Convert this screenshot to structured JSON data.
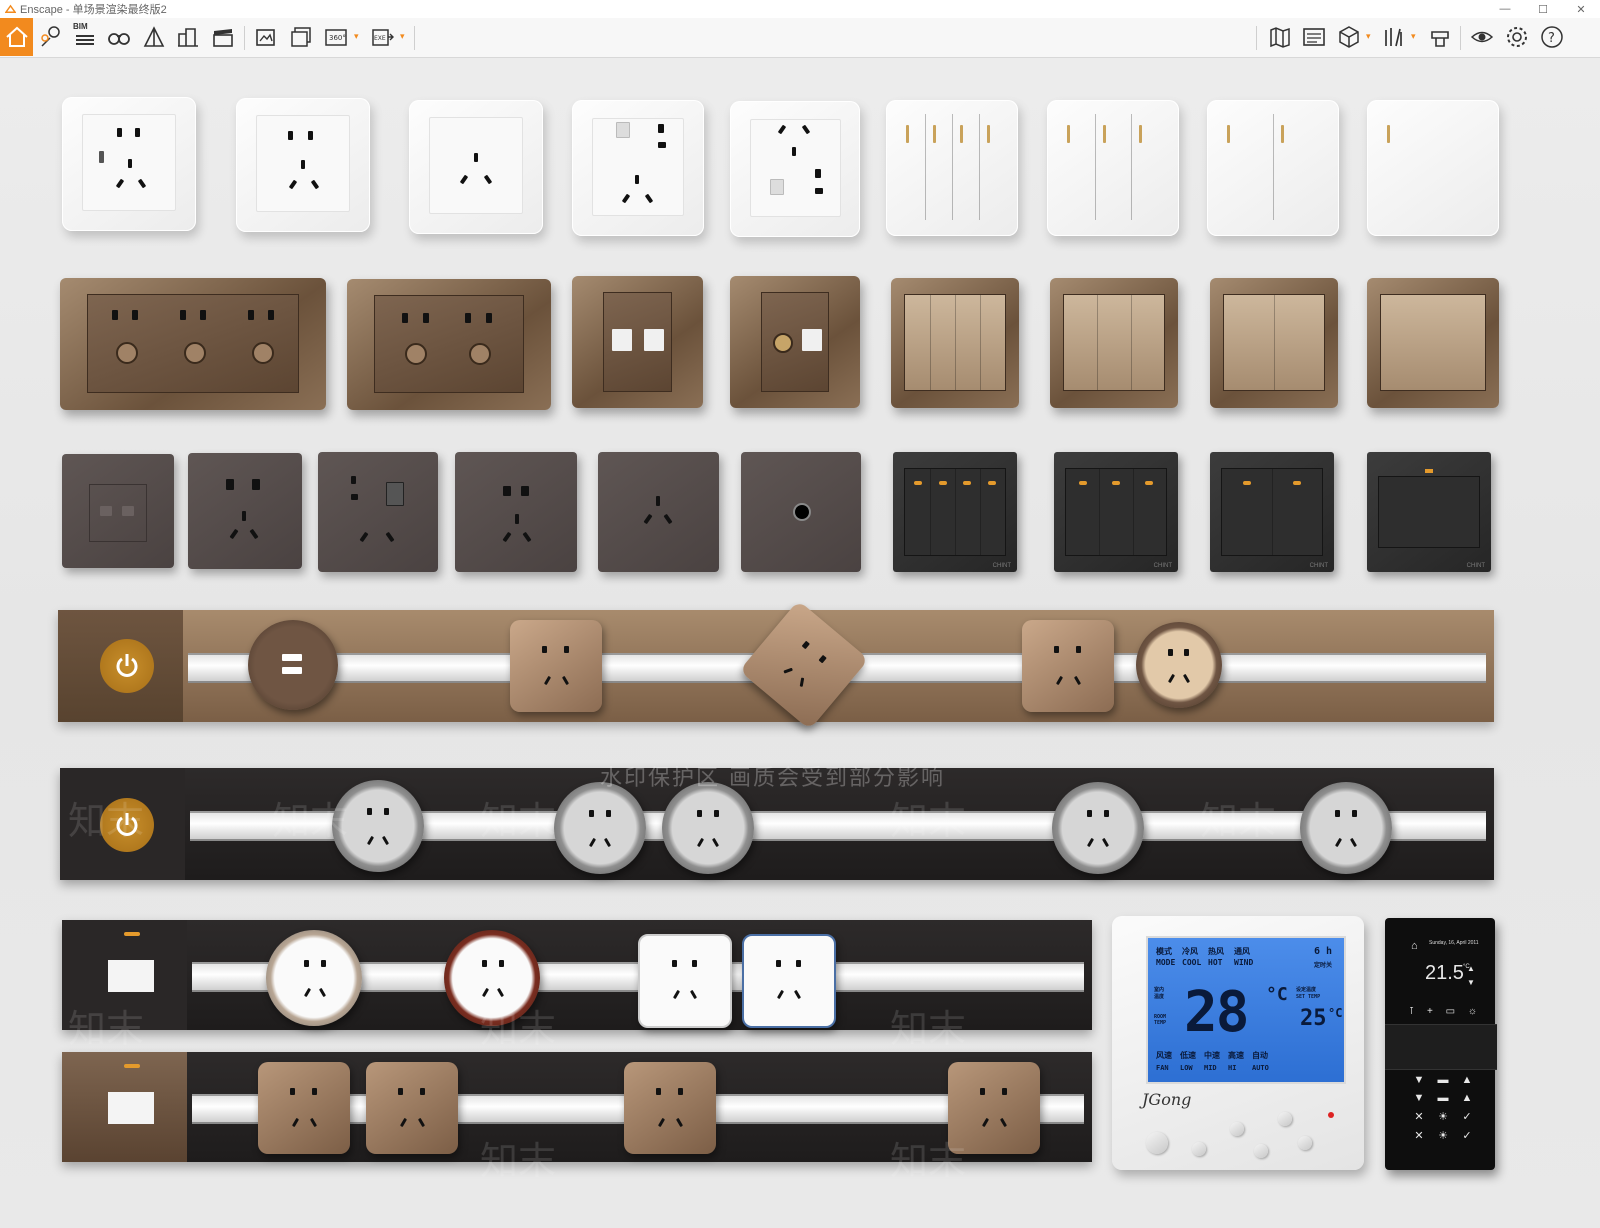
{
  "window": {
    "title": "Enscape - 单场景渲染最终版2",
    "controls": [
      "minimize",
      "maximize",
      "close"
    ]
  },
  "toolbar": {
    "left_icons": [
      "home-icon",
      "location-pin-icon",
      "bim-icon",
      "binoculars-icon",
      "tent-icon",
      "buildings-icon",
      "clapperboard-icon",
      "screenshot-icon",
      "batch-render-icon",
      "panorama-360-icon",
      "export-exe-icon"
    ],
    "right_icons": [
      "map-icon",
      "info-panel-icon",
      "cube-icon",
      "asset-library-icon",
      "material-editor-icon",
      "visibility-icon",
      "settings-icon",
      "help-icon"
    ],
    "bim_label": "BIM",
    "panorama_label": "360°",
    "exe_label": "EXE",
    "accent": "#f28a1e"
  },
  "watermark": {
    "notice": "水印保护区   画质会受到部分影响",
    "brand": "知末"
  },
  "brand_labels": {
    "plate": "CHINT"
  },
  "thermostat": {
    "mode_cn": [
      "模式",
      "冷风",
      "热风",
      "通风"
    ],
    "mode_en": [
      "MODE",
      "COOL",
      "HOT",
      "WIND"
    ],
    "timer": "6 h",
    "timer_sub": "定时关",
    "room_temp_label": "室内温度",
    "room_temp_en": "ROOM TEMP",
    "set_temp_label": "设定温度",
    "set_temp_en": "SET TEMP",
    "room_temp": "28",
    "set_temp": "25",
    "unit": "°C",
    "fan_cn": [
      "风速",
      "低速",
      "中速",
      "高速",
      "自动"
    ],
    "fan_en": [
      "FAN",
      "LOW",
      "MID",
      "HI",
      "AUTO"
    ],
    "brand": "JGong"
  },
  "smart_panel": {
    "date": "Sunday, 16, April 2011",
    "temperature": "21.5",
    "unit": "°C",
    "buttons": [
      "▼",
      "▬",
      "▲",
      "▼",
      "▬",
      "▲",
      "✕",
      "☀",
      "✓",
      "✕",
      "☀",
      "✓"
    ]
  }
}
